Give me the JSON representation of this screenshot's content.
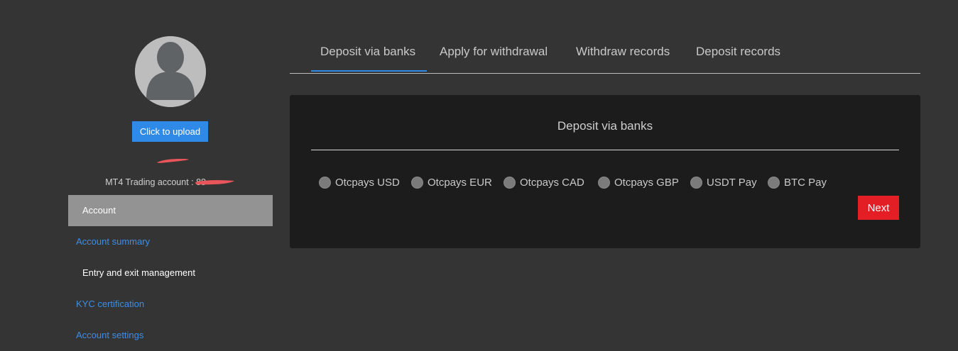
{
  "sidebar": {
    "upload_label": "Click to upload",
    "mt4_label": "MT4 Trading account : ",
    "account_number_partial": "88",
    "menu": [
      {
        "label": "Account"
      },
      {
        "label": "Account summary"
      },
      {
        "label": "Entry and exit management"
      },
      {
        "label": "KYC certification"
      },
      {
        "label": "Account settings"
      }
    ]
  },
  "tabs": [
    {
      "label": "Deposit via banks",
      "active": true
    },
    {
      "label": "Apply for withdrawal"
    },
    {
      "label": "Withdraw records"
    },
    {
      "label": "Deposit records"
    }
  ],
  "panel": {
    "title": "Deposit via banks",
    "options": [
      {
        "label": "Otcpays USD"
      },
      {
        "label": "Otcpays EUR"
      },
      {
        "label": "Otcpays CAD"
      },
      {
        "label": "Otcpays GBP"
      },
      {
        "label": "USDT Pay"
      },
      {
        "label": "BTC Pay"
      }
    ],
    "next_label": "Next"
  },
  "icons": {
    "avatar": "user-silhouette-icon",
    "radio": "radio-unchecked-icon"
  },
  "colors": {
    "accent_blue": "#2e8ae6",
    "link_blue": "#3d8ee6",
    "next_red": "#e31e24",
    "redaction": "#e8555a"
  }
}
